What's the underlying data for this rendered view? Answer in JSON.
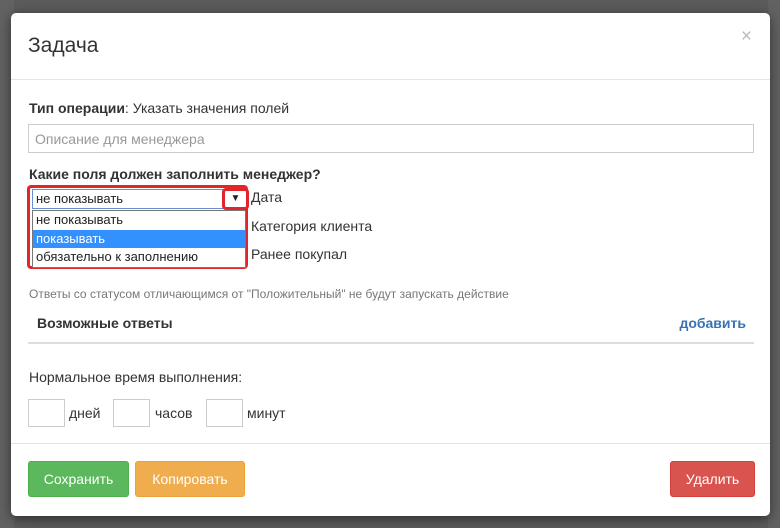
{
  "modal": {
    "title": "Задача",
    "close_label": "×"
  },
  "operation": {
    "label": "Тип операции",
    "value": ": Указать значения полей"
  },
  "description": {
    "placeholder": "Описание для менеджера"
  },
  "fields": {
    "question": "Какие поля должен заполнить менеджер?",
    "selected_value": "не показывать",
    "options": [
      "не показывать",
      "показывать",
      "обязательно к заполнению"
    ],
    "highlighted_option": "показывать",
    "names": [
      "Дата",
      "Категория клиента",
      "Ранее покупал"
    ]
  },
  "answers": {
    "hint": "Ответы со статусом отличающимся от \"Положительный\" не будут запускать действие",
    "title": "Возможные ответы",
    "add_label": "добавить"
  },
  "time": {
    "label": "Нормальное время выполнения:",
    "units": [
      "дней",
      "часов",
      "минут"
    ]
  },
  "footer": {
    "save_label": "Сохранить",
    "copy_label": "Копировать",
    "delete_label": "Удалить"
  },
  "colors": {
    "save": "#5cb85c",
    "copy": "#f0ad4e",
    "delete": "#d9534f",
    "highlight": "#e0262b",
    "selected_option": "#3390ff",
    "link": "#3872b4"
  }
}
